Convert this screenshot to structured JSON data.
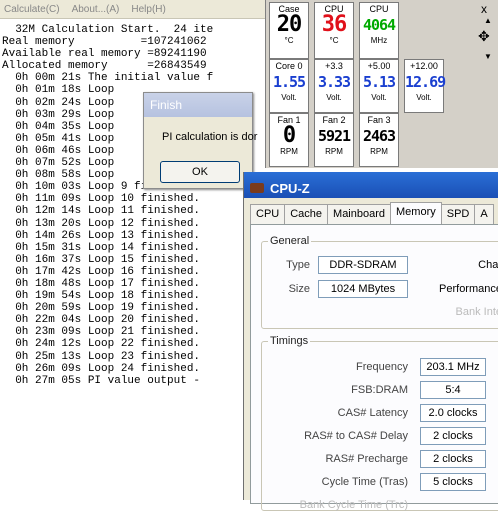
{
  "superpi": {
    "menu": [
      "Calculate(C)",
      "About...(A)",
      "Help(H)"
    ],
    "lines": [
      "  32M Calculation Start.  24 ite",
      "Real memory          =107241062",
      "Available real memory =89241190",
      "Allocated memory      =26843549",
      "  0h 00m 21s The initial value f",
      "  0h 01m 18s Loop",
      "  0h 02m 24s Loop",
      "  0h 03m 29s Loop",
      "  0h 04m 35s Loop",
      "  0h 05m 41s Loop",
      "  0h 06m 46s Loop",
      "  0h 07m 52s Loop",
      "  0h 08m 58s Loop",
      "  0h 10m 03s Loop 9 finished.",
      "  0h 11m 09s Loop 10 finished.",
      "  0h 12m 14s Loop 11 finished.",
      "  0h 13m 20s Loop 12 finished.",
      "  0h 14m 26s Loop 13 finished.",
      "  0h 15m 31s Loop 14 finished.",
      "  0h 16m 37s Loop 15 finished.",
      "  0h 17m 42s Loop 16 finished.",
      "  0h 18m 48s Loop 17 finished.",
      "  0h 19m 54s Loop 18 finished.",
      "  0h 20m 59s Loop 19 finished.",
      "  0h 22m 04s Loop 20 finished.",
      "  0h 23m 09s Loop 21 finished.",
      "  0h 24m 12s Loop 22 finished.",
      "  0h 25m 13s Loop 23 finished.",
      "  0h 26m 09s Loop 24 finished.",
      "  0h 27m 05s PI value output -"
    ]
  },
  "finish_dialog": {
    "title": "Finish",
    "message": "PI calculation is dor",
    "ok_label": "OK"
  },
  "hwmon": {
    "tiles": [
      {
        "label": "Case",
        "value": "20",
        "unit": "°C",
        "color": "#000000"
      },
      {
        "label": "CPU",
        "value": "36",
        "unit": "°C",
        "color": "#e0101a"
      },
      {
        "label": "CPU",
        "value": "4064",
        "unit": "MHz",
        "color": "#00aa00"
      },
      {
        "label": "Core 0",
        "value": "1.55",
        "unit": "Volt.",
        "color": "#1a3fd0"
      },
      {
        "label": "+3.3",
        "value": "3.33",
        "unit": "Volt.",
        "color": "#1a3fd0"
      },
      {
        "label": "+5.00",
        "value": "5.13",
        "unit": "Volt.",
        "color": "#1a3fd0"
      },
      {
        "label": "+12.00",
        "value": "12.69",
        "unit": "Volt.",
        "color": "#1a3fd0"
      },
      {
        "label": "Fan 1",
        "value": "0",
        "unit": "RPM",
        "color": "#000000"
      },
      {
        "label": "Fan 2",
        "value": "5921",
        "unit": "RPM",
        "color": "#000000"
      },
      {
        "label": "Fan 3",
        "value": "2463",
        "unit": "RPM",
        "color": "#000000"
      }
    ],
    "close_glyph": "x",
    "move_glyph": "✥"
  },
  "cpuz": {
    "title": "CPU-Z",
    "tabs": [
      "CPU",
      "Cache",
      "Mainboard",
      "Memory",
      "SPD",
      "A"
    ],
    "active_tab": "Memory",
    "general": {
      "group_label": "General",
      "type_label": "Type",
      "type_value": "DDR-SDRAM",
      "size_label": "Size",
      "size_value": "1024 MBytes",
      "channels_label": "Char",
      "perf_label": "Performance",
      "bank_label": "Bank Inte"
    },
    "timings": {
      "group_label": "Timings",
      "rows": [
        {
          "label": "Frequency",
          "value": "203.1 MHz"
        },
        {
          "label": "FSB:DRAM",
          "value": "5:4"
        },
        {
          "label": "CAS# Latency",
          "value": "2.0 clocks"
        },
        {
          "label": "RAS# to CAS# Delay",
          "value": "2 clocks"
        },
        {
          "label": "RAS# Precharge",
          "value": "2 clocks"
        },
        {
          "label": "Cycle Time (Tras)",
          "value": "5 clocks"
        },
        {
          "label": "Bank Cycle Time (Trc)",
          "value": ""
        }
      ]
    }
  }
}
